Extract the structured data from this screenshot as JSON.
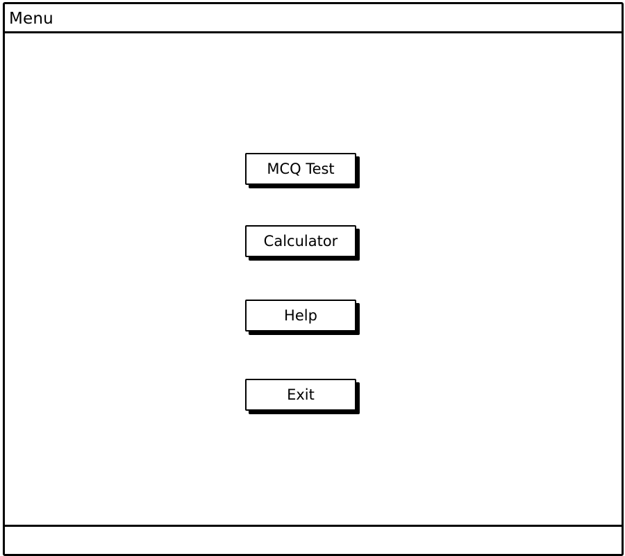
{
  "window": {
    "title": "Menu",
    "status_text": ""
  },
  "menu": {
    "buttons": [
      {
        "label": "MCQ Test"
      },
      {
        "label": "Calculator"
      },
      {
        "label": "Help"
      },
      {
        "label": "Exit"
      }
    ]
  },
  "colors": {
    "border": "#000000",
    "background": "#ffffff",
    "text": "#000000"
  }
}
